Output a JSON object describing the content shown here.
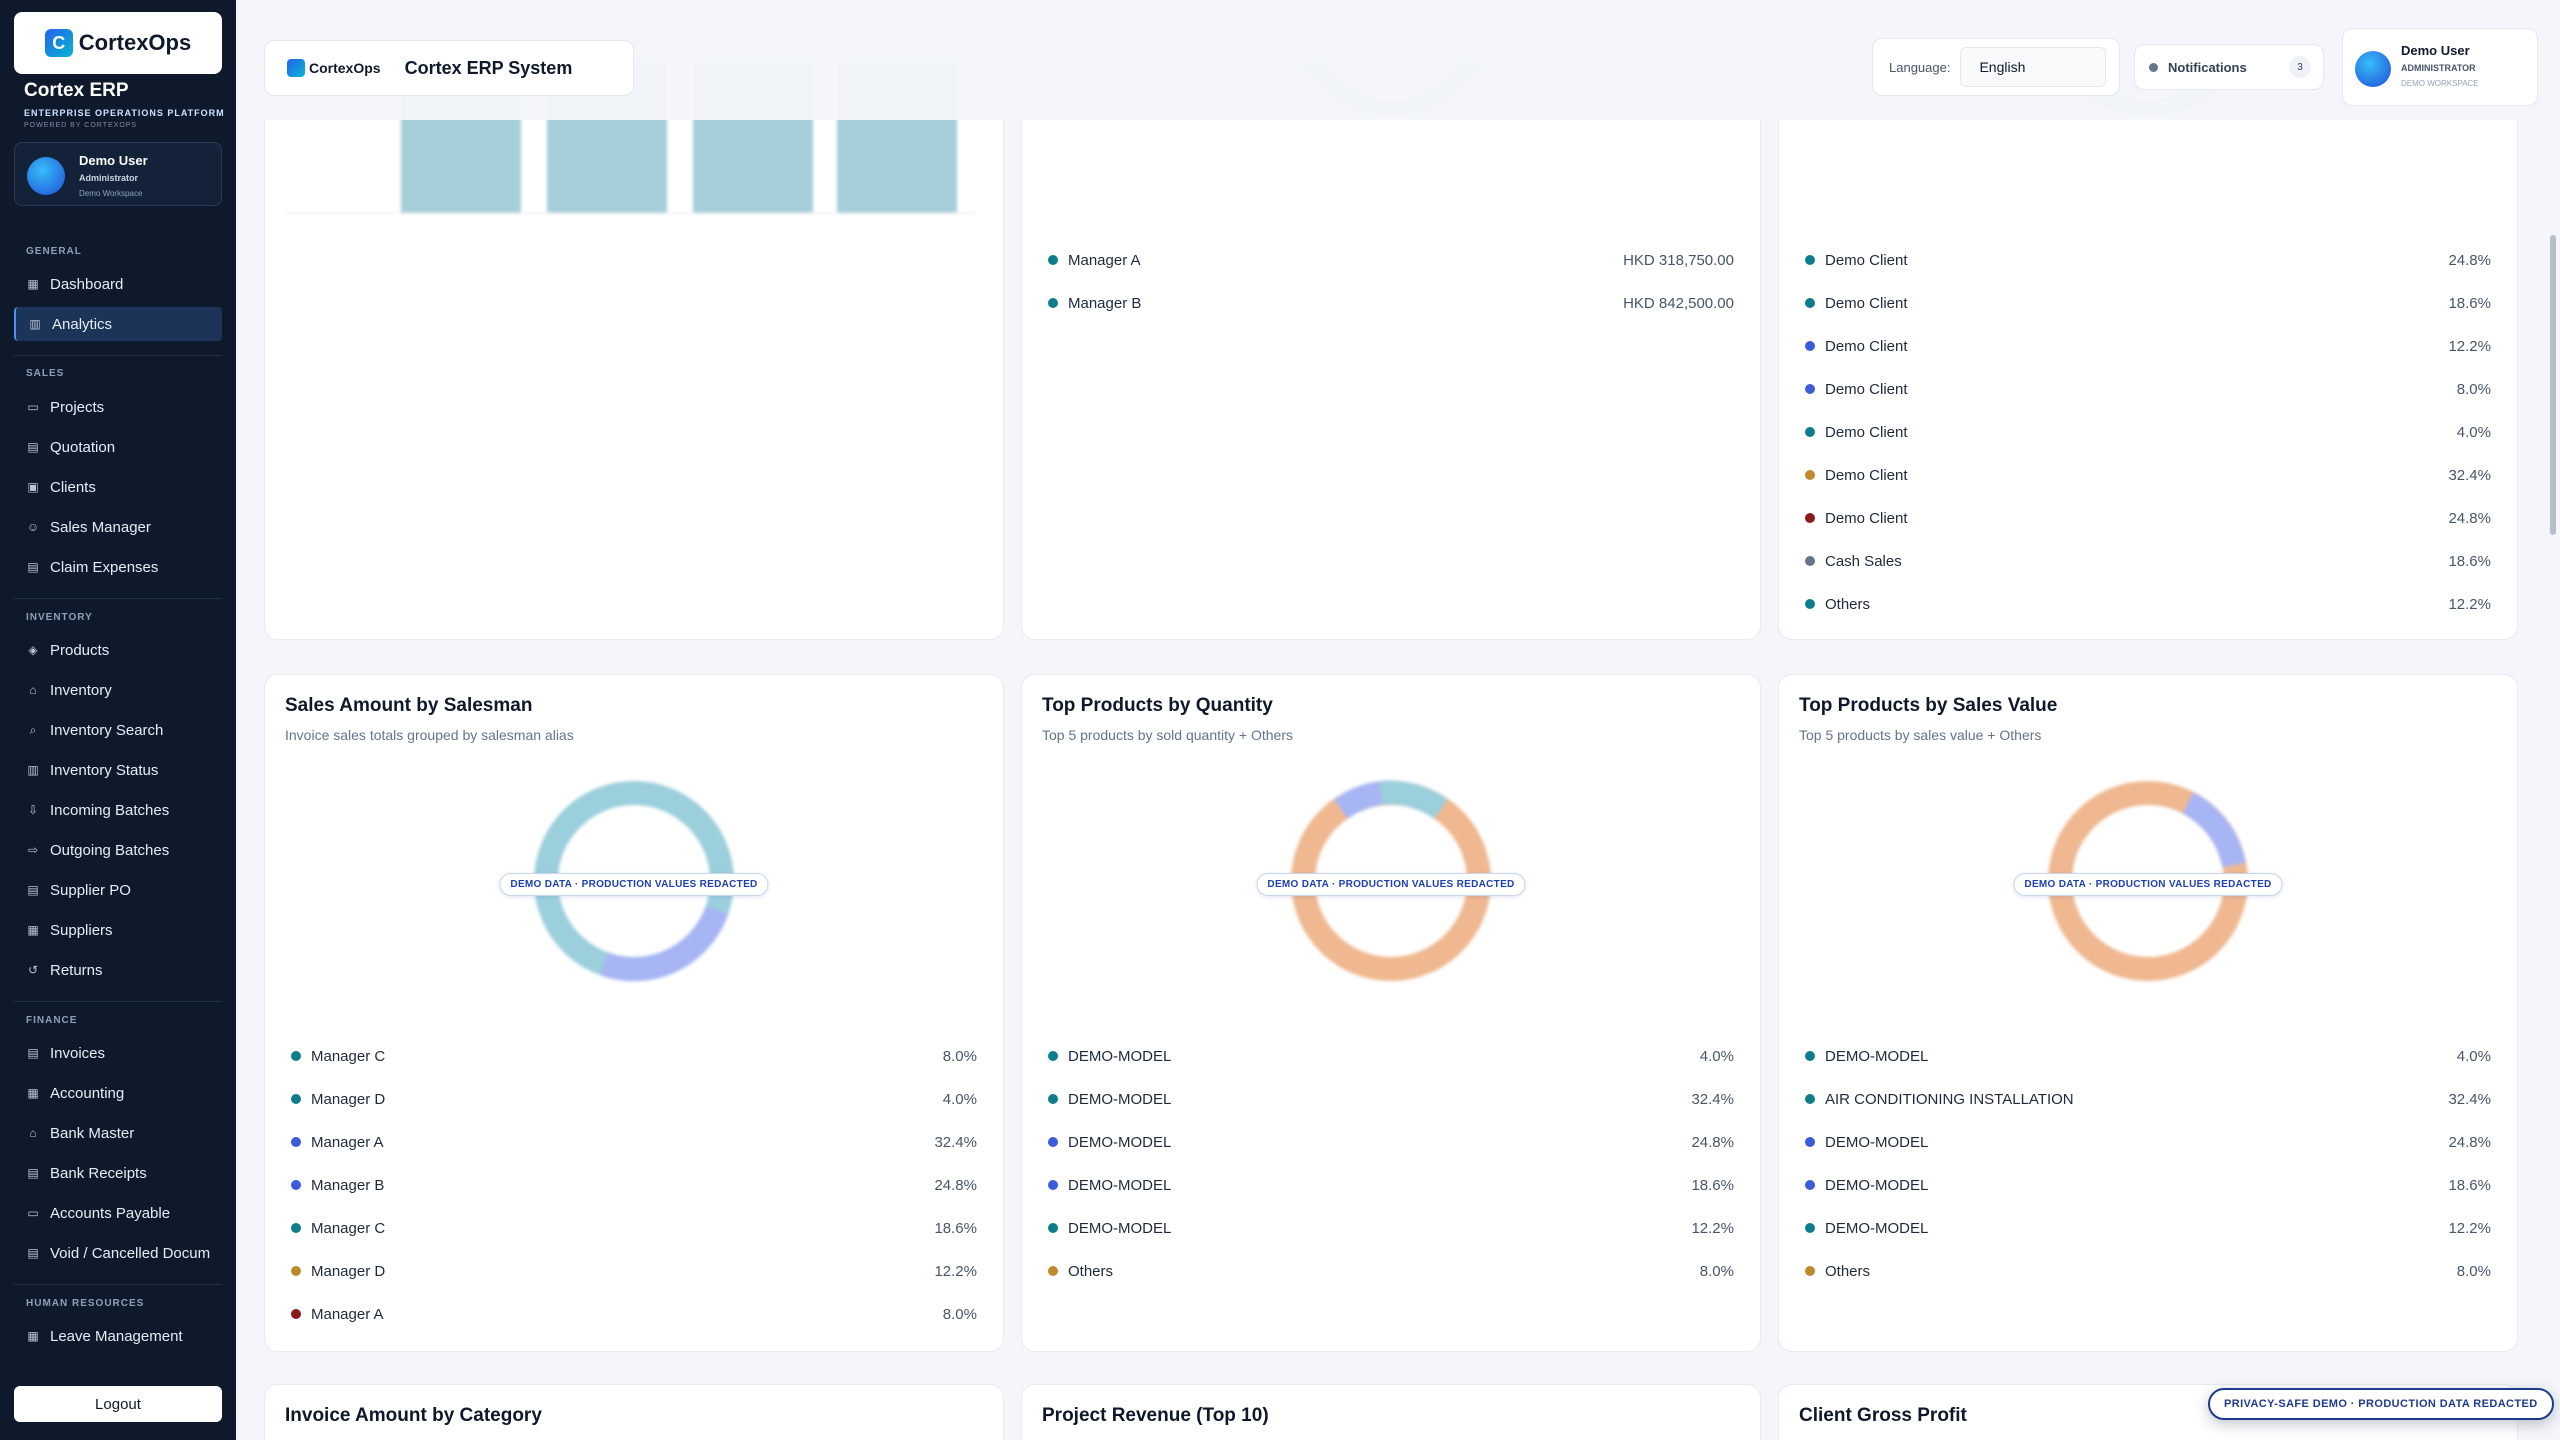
{
  "sidebar": {
    "logo_mark": "C",
    "logo_text": "CortexOps",
    "logo_tag": "OPERATIONS PLATFORM",
    "app_title": "Cortex ERP",
    "app_subtitle": "ENTERPRISE OPERATIONS PLATFORM",
    "app_powered": "POWERED BY CORTEXOPS",
    "user": {
      "name": "Demo User",
      "role": "Administrator",
      "workspace": "Demo Workspace"
    },
    "sections": {
      "general": "GENERAL",
      "sales": "SALES",
      "inventory": "INVENTORY",
      "finance": "FINANCE",
      "hr": "HUMAN RESOURCES"
    },
    "items": {
      "dashboard": "Dashboard",
      "analytics": "Analytics",
      "projects": "Projects",
      "quotation": "Quotation",
      "clients": "Clients",
      "sales_manager": "Sales Manager",
      "claim_expenses": "Claim Expenses",
      "products": "Products",
      "inventory": "Inventory",
      "inventory_search": "Inventory Search",
      "inventory_status": "Inventory Status",
      "incoming_batches": "Incoming Batches",
      "outgoing_batches": "Outgoing Batches",
      "supplier_po": "Supplier PO",
      "suppliers": "Suppliers",
      "returns": "Returns",
      "invoices": "Invoices",
      "accounting": "Accounting",
      "bank_master": "Bank Master",
      "bank_receipts": "Bank Receipts",
      "accounts_payable": "Accounts Payable",
      "void_docs": "Void / Cancelled Docum",
      "leave_management": "Leave Management"
    },
    "logout": "Logout"
  },
  "topbar": {
    "brand_logo": "CortexOps",
    "title": "Cortex ERP System",
    "language_label": "Language:",
    "language_value": "English",
    "notifications_label": "Notifications",
    "notifications_count": "3",
    "user": {
      "name": "Demo User",
      "role": "ADMINISTRATOR",
      "workspace": "DEMO WORKSPACE"
    }
  },
  "colors": {
    "teal": "#0f7c8c",
    "blue": "#3b5bdb",
    "gold": "#c08a2c",
    "maroon": "#8b1a1a",
    "gray": "#64748b",
    "donut_teal": "#9ccfdc",
    "donut_blue": "#a7b5f5",
    "donut_orange": "#efb890"
  },
  "top_row": {
    "middle_legend": [
      {
        "label": "Manager A",
        "value": "HKD 318,750.00",
        "color": "#0f7c8c"
      },
      {
        "label": "Manager B",
        "value": "HKD 842,500.00",
        "color": "#0f7c8c"
      }
    ],
    "right_legend": [
      {
        "label": "Demo Client",
        "value": "24.8%",
        "color": "#0f7c8c"
      },
      {
        "label": "Demo Client",
        "value": "18.6%",
        "color": "#0f7c8c"
      },
      {
        "label": "Demo Client",
        "value": "12.2%",
        "color": "#3b5bdb"
      },
      {
        "label": "Demo Client",
        "value": "8.0%",
        "color": "#3b5bdb"
      },
      {
        "label": "Demo Client",
        "value": "4.0%",
        "color": "#0f7c8c"
      },
      {
        "label": "Demo Client",
        "value": "32.4%",
        "color": "#c08a2c"
      },
      {
        "label": "Demo Client",
        "value": "24.8%",
        "color": "#8b1a1a"
      },
      {
        "label": "Cash Sales",
        "value": "18.6%",
        "color": "#64748b"
      },
      {
        "label": "Others",
        "value": "12.2%",
        "color": "#0f7c8c"
      }
    ]
  },
  "cards": {
    "salesman": {
      "title": "Sales Amount by Salesman",
      "subtitle": "Invoice sales totals grouped by salesman alias",
      "badge": "DEMO DATA · PRODUCTION VALUES REDACTED",
      "legend": [
        {
          "label": "Manager C",
          "value": "8.0%",
          "color": "#0f7c8c"
        },
        {
          "label": "Manager D",
          "value": "4.0%",
          "color": "#0f7c8c"
        },
        {
          "label": "Manager A",
          "value": "32.4%",
          "color": "#3b5bdb"
        },
        {
          "label": "Manager B",
          "value": "24.8%",
          "color": "#3b5bdb"
        },
        {
          "label": "Manager C",
          "value": "18.6%",
          "color": "#0f7c8c"
        },
        {
          "label": "Manager D",
          "value": "12.2%",
          "color": "#c08a2c"
        },
        {
          "label": "Manager A",
          "value": "8.0%",
          "color": "#8b1a1a"
        }
      ]
    },
    "qty": {
      "title": "Top Products by Quantity",
      "subtitle": "Top 5 products by sold quantity + Others",
      "badge": "DEMO DATA · PRODUCTION VALUES REDACTED",
      "legend": [
        {
          "label": "DEMO-MODEL",
          "value": "4.0%",
          "color": "#0f7c8c"
        },
        {
          "label": "DEMO-MODEL",
          "value": "32.4%",
          "color": "#0f7c8c"
        },
        {
          "label": "DEMO-MODEL",
          "value": "24.8%",
          "color": "#3b5bdb"
        },
        {
          "label": "DEMO-MODEL",
          "value": "18.6%",
          "color": "#3b5bdb"
        },
        {
          "label": "DEMO-MODEL",
          "value": "12.2%",
          "color": "#0f7c8c"
        },
        {
          "label": "Others",
          "value": "8.0%",
          "color": "#c08a2c"
        }
      ]
    },
    "value": {
      "title": "Top Products by Sales Value",
      "subtitle": "Top 5 products by sales value + Others",
      "badge": "DEMO DATA · PRODUCTION VALUES REDACTED",
      "legend": [
        {
          "label": "DEMO-MODEL",
          "value": "4.0%",
          "color": "#0f7c8c"
        },
        {
          "label": "AIR CONDITIONING INSTALLATION",
          "value": "32.4%",
          "color": "#0f7c8c"
        },
        {
          "label": "DEMO-MODEL",
          "value": "24.8%",
          "color": "#3b5bdb"
        },
        {
          "label": "DEMO-MODEL",
          "value": "18.6%",
          "color": "#3b5bdb"
        },
        {
          "label": "DEMO-MODEL",
          "value": "12.2%",
          "color": "#0f7c8c"
        },
        {
          "label": "Others",
          "value": "8.0%",
          "color": "#c08a2c"
        }
      ]
    },
    "category": {
      "title": "Invoice Amount by Category"
    },
    "project": {
      "title": "Project Revenue (Top 10)"
    },
    "gross": {
      "title": "Client Gross Profit"
    }
  },
  "privacy_badge": "PRIVACY-SAFE DEMO · PRODUCTION DATA REDACTED"
}
